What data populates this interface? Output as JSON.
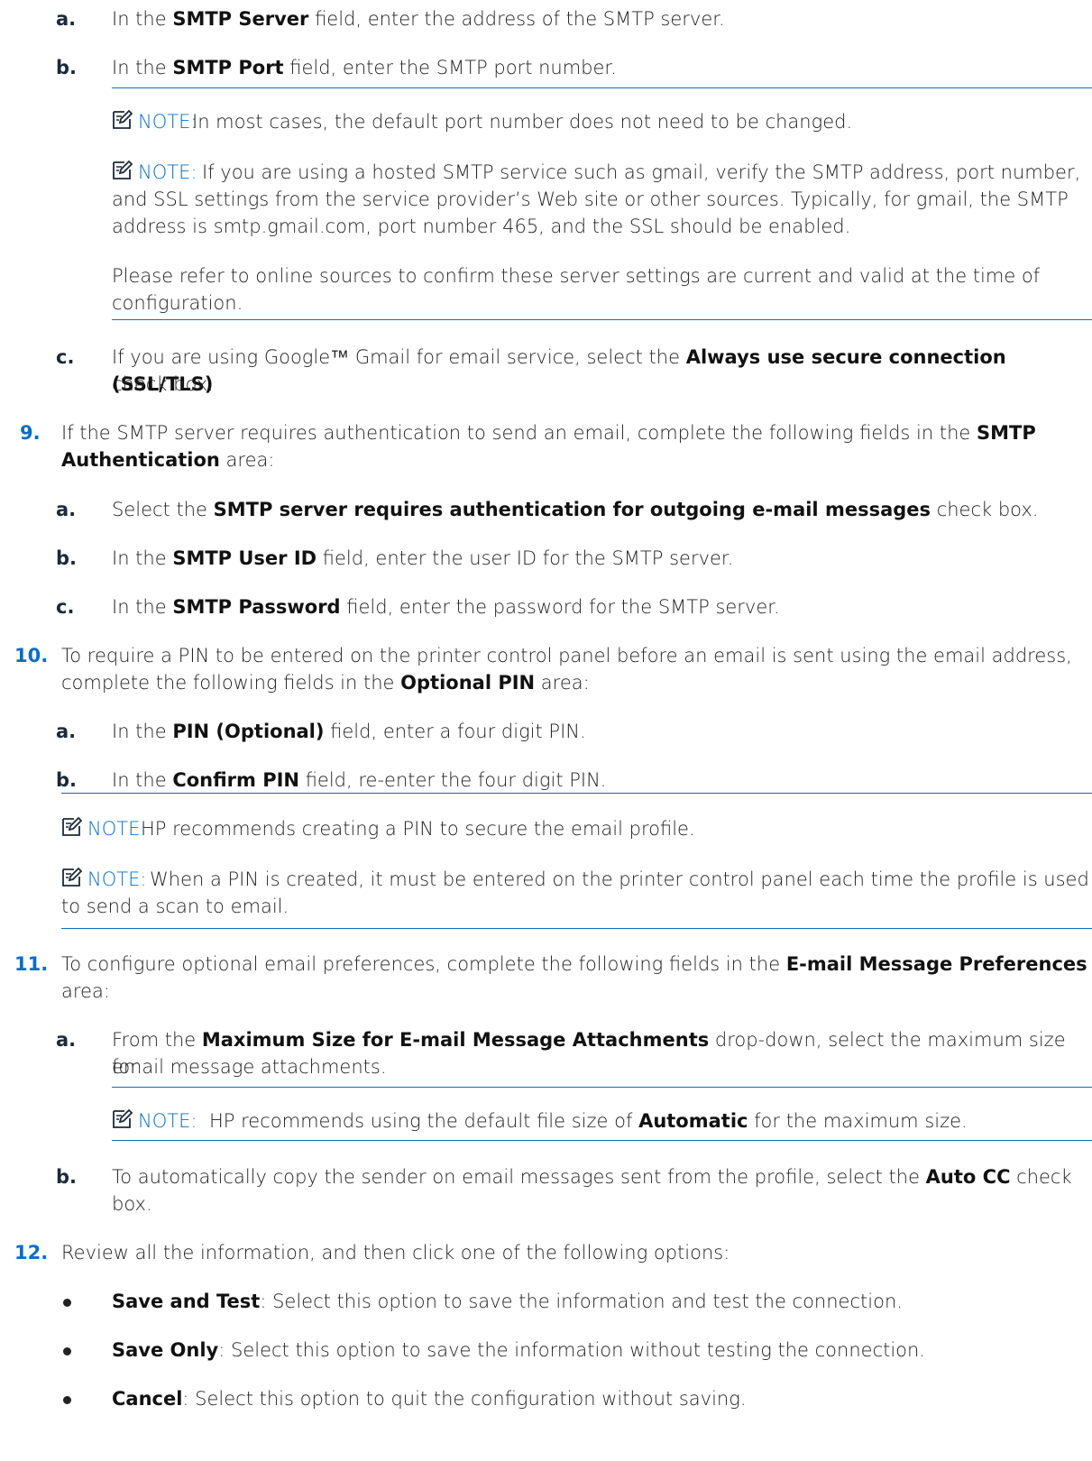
{
  "items": {
    "s8a": {
      "marker": "a.",
      "pre": "In the ",
      "bold": "SMTP Server",
      "post": " field, enter the address of the SMTP server."
    },
    "s8b": {
      "marker": "b.",
      "pre": "In the ",
      "bold": "SMTP Port",
      "post": " field, enter the SMTP port number."
    },
    "n1": {
      "label": "NOTE:",
      "text": "In most cases, the default port number does not need to be changed."
    },
    "n2": {
      "label": "NOTE:",
      "l1": "If you are using a hosted SMTP service such as gmail, verify the SMTP address, port number,",
      "l2": "and SSL settings from the service provider’s Web site or other sources. Typically, for gmail, the SMTP",
      "l3": "address is smtp.gmail.com, port number 465, and the SSL should be enabled.",
      "p2l1": "Please refer to online sources to confirm these server settings are current and valid at the time of",
      "p2l2": "configuration."
    },
    "s8c": {
      "marker": "c.",
      "pre": "If you are using Google™ Gmail for email service, select the ",
      "bold": "Always use secure connection (SSL/TLS)",
      "l2": "check box."
    },
    "s9": {
      "marker": "9.",
      "pre": "If the SMTP server requires authentication to send an email, complete the following fields in the ",
      "bold": "SMTP",
      "bold2": "Authentication",
      "post": " area:"
    },
    "s9a": {
      "marker": "a.",
      "pre": "Select the ",
      "bold": "SMTP server requires authentication for outgoing e-mail messages",
      "post": " check box."
    },
    "s9b": {
      "marker": "b.",
      "pre": "In the ",
      "bold": "SMTP User ID",
      "post": " field, enter the user ID for the SMTP server."
    },
    "s9c": {
      "marker": "c.",
      "pre": "In the ",
      "bold": "SMTP Password",
      "post": " field, enter the password for the SMTP server."
    },
    "s10": {
      "marker": "10.",
      "l1": "To require a PIN to be entered on the printer control panel before an email is sent using the email address,",
      "pre": "complete the following fields in the ",
      "bold": "Optional PIN",
      "post": " area:"
    },
    "s10a": {
      "marker": "a.",
      "pre": "In the ",
      "bold": "PIN (Optional)",
      "post": " field, enter a four digit PIN."
    },
    "s10b": {
      "marker": "b.",
      "pre": "In the ",
      "bold": "Confirm PIN",
      "post": " field, re-enter the four digit PIN."
    },
    "n3": {
      "label": "NOTE:",
      "text": "HP recommends creating a PIN to secure the email profile."
    },
    "n4": {
      "label": "NOTE:",
      "l1": "When a PIN is created, it must be entered on the printer control panel each time the profile is used",
      "l2": "to send a scan to email."
    },
    "s11": {
      "marker": "11.",
      "pre": "To configure optional email preferences, complete the following fields in the ",
      "bold": "E-mail Message Preferences",
      "l2": "area:"
    },
    "s11a": {
      "marker": "a.",
      "pre": "From the ",
      "bold": "Maximum Size for E-mail Message Attachments",
      "post": " drop-down, select the maximum size for",
      "l2": "email message attachments."
    },
    "n5": {
      "label": "NOTE:",
      "pre": "HP recommends using the default file size of ",
      "bold": "Automatic",
      "post": " for the maximum size."
    },
    "s11b": {
      "marker": "b.",
      "pre": "To automatically copy the sender on email messages sent from the profile, select the ",
      "bold": "Auto CC",
      "post": " check",
      "l2": "box."
    },
    "s12": {
      "marker": "12.",
      "text": "Review all the information, and then click one of the following options:"
    },
    "opt1": {
      "bold": "Save and Test",
      "post": ": Select this option to save the information and test the connection."
    },
    "opt2": {
      "bold": "Save Only",
      "post": ": Select this option to save the information without testing the connection."
    },
    "opt3": {
      "bold": "Cancel",
      "post": ": Select this option to quit the configuration without saving."
    }
  },
  "icons": {
    "note": "note-pencil-icon"
  },
  "colors": {
    "accent": "#0b6ec3",
    "text": "#222222"
  }
}
